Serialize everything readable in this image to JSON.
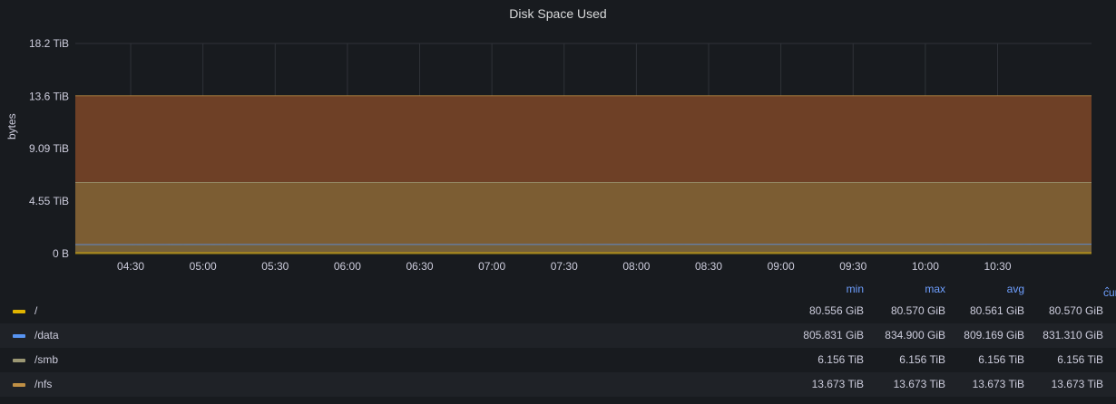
{
  "panel": {
    "title": "Disk Space Used"
  },
  "chart_data": {
    "type": "area",
    "title": "Disk Space Used",
    "ylabel": "bytes",
    "xlabel": "",
    "y_unit": "TiB",
    "ylim": [
      0,
      18.2
    ],
    "y_ticks": [
      {
        "value": 0,
        "label": "0 B"
      },
      {
        "value": 4.55,
        "label": "4.55 TiB"
      },
      {
        "value": 9.09,
        "label": "9.09 TiB"
      },
      {
        "value": 13.6,
        "label": "13.6 TiB"
      },
      {
        "value": 18.2,
        "label": "18.2 TiB"
      }
    ],
    "x_range": [
      "04:07",
      "11:09"
    ],
    "x_ticks": [
      "04:30",
      "05:00",
      "05:30",
      "06:00",
      "06:30",
      "07:00",
      "07:30",
      "08:00",
      "08:30",
      "09:00",
      "09:30",
      "10:00",
      "10:30"
    ],
    "grid": true,
    "stacked": false,
    "legend_placement": "bottom",
    "series": [
      {
        "name": "/",
        "color": "#e0b400",
        "values_tib": [
          0.0787,
          0.0787
        ],
        "min": "80.556 GiB",
        "max": "80.570 GiB",
        "avg": "80.561 GiB",
        "current": "80.570 GiB"
      },
      {
        "name": "/data",
        "color": "#5794f2",
        "values_tib": [
          0.786,
          0.812
        ],
        "min": "805.831 GiB",
        "max": "834.900 GiB",
        "avg": "809.169 GiB",
        "current": "831.310 GiB"
      },
      {
        "name": "/smb",
        "color": "#9b9773",
        "values_tib": [
          6.156,
          6.156
        ],
        "min": "6.156 TiB",
        "max": "6.156 TiB",
        "avg": "6.156 TiB",
        "current": "6.156 TiB"
      },
      {
        "name": "/nfs",
        "color": "#c09045",
        "values_tib": [
          13.673,
          13.673
        ],
        "min": "13.673 TiB",
        "max": "13.673 TiB",
        "avg": "13.673 TiB",
        "current": "13.673 TiB"
      }
    ]
  },
  "legend": {
    "columns": {
      "min": "min",
      "max": "max",
      "avg": "avg",
      "current": "current"
    },
    "sort_icon": "caret-up-icon"
  },
  "colors": {
    "background": "#181b1f",
    "grid": "#2f3238",
    "accent": "#6e9fff",
    "nfs_fill": "#6e4026",
    "smb_fill": "#7c5d33",
    "data_fill": "#75603a"
  }
}
